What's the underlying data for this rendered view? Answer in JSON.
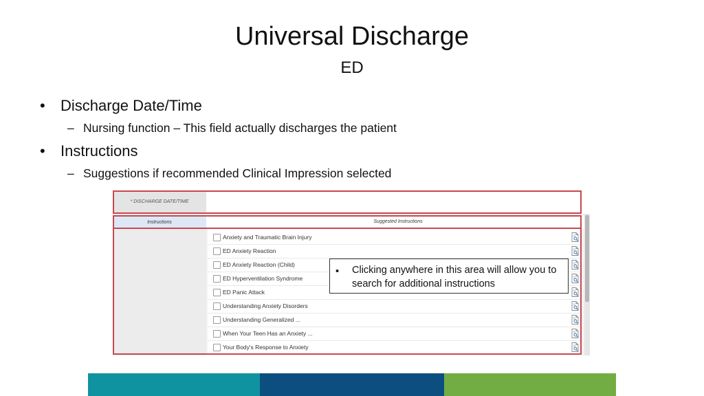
{
  "slide": {
    "title": "Universal Discharge",
    "subtitle": "ED"
  },
  "bullets": [
    {
      "text": "Discharge Date/Time",
      "sub": "Nursing function – This field actually discharges the patient"
    },
    {
      "text": "Instructions",
      "sub": "Suggestions if recommended Clinical Impression selected"
    }
  ],
  "bullet_glyph": "•",
  "sub_glyph": "–",
  "screenshot": {
    "date_label": "* DISCHARGE DATE/TIME",
    "instructions_tab": "Instructions",
    "suggested_header": "Suggested Instructions",
    "items": [
      "Anxiety and Traumatic Brain Injury",
      "ED Anxiety Reaction",
      "ED Anxiety Reaction (Child)",
      "ED Hyperventilation Syndrome",
      "ED Panic Attack",
      "Understanding Anxiety Disorders",
      "Understanding Generalized ...",
      "When Your Teen Has an Anxiety ...",
      "Your Body's Response to Anxiety"
    ],
    "item_icon": "document-search-icon"
  },
  "callout": {
    "bullet": "•",
    "text": "Clicking anywhere in this area will allow you to search for additional instructions"
  },
  "colors": {
    "highlight_border": "#c9474f",
    "footer_teal": "#0f93a0",
    "footer_navy": "#0d4e81",
    "footer_green": "#71ad43"
  }
}
